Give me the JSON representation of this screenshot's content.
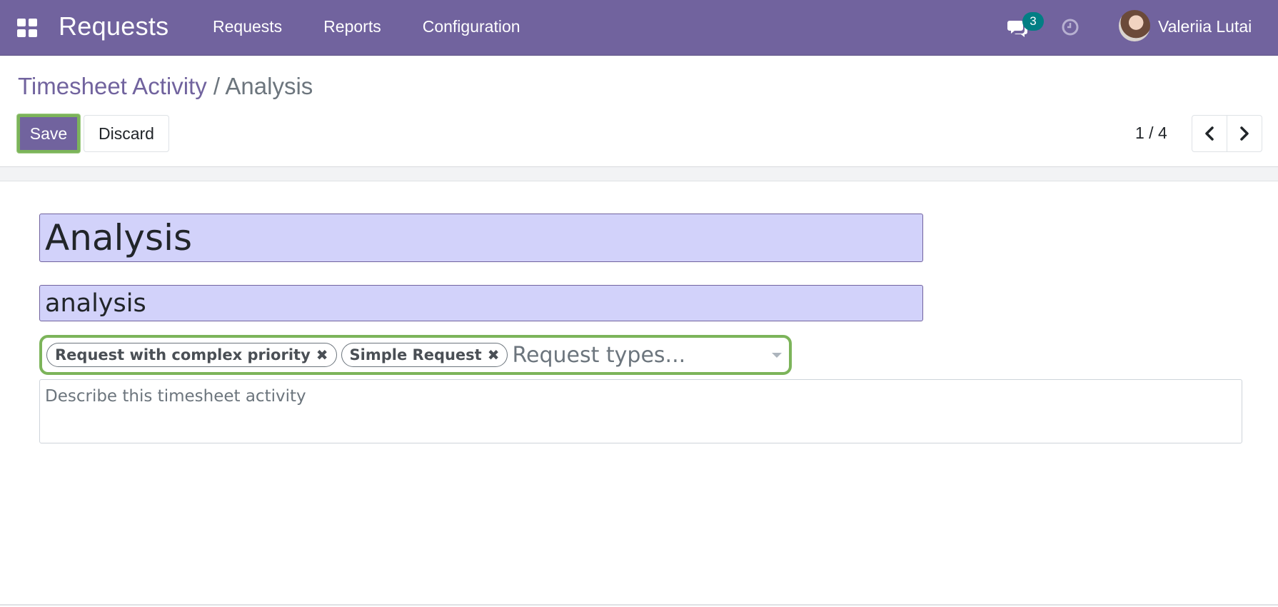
{
  "navbar": {
    "apps_icon": "grid-icon",
    "app_title": "Requests",
    "menu": [
      {
        "label": "Requests"
      },
      {
        "label": "Reports"
      },
      {
        "label": "Configuration"
      }
    ],
    "chat_icon": "chat-icon",
    "chat_badge_count": "3",
    "activity_icon": "clock-icon",
    "user_name": "Valeriia Lutai",
    "brand_color": "#71639e"
  },
  "control_panel": {
    "breadcrumb_parent": "Timesheet Activity",
    "breadcrumb_separator": " / ",
    "breadcrumb_current": "Analysis",
    "save_label": "Save",
    "discard_label": "Discard",
    "pager_value": "1 / 4",
    "prev_icon": "chevron-left-icon",
    "next_icon": "chevron-right-icon"
  },
  "form": {
    "name_value": "Analysis",
    "code_value": "analysis",
    "request_types": {
      "tags": [
        {
          "label": "Request with complex priority"
        },
        {
          "label": "Simple Request"
        }
      ],
      "placeholder": "Request types...",
      "remove_icon": "close-icon"
    },
    "description_placeholder": "Describe this timesheet activity",
    "highlight_color": "#7cb45a",
    "input_bg_color": "#d2d2fa"
  }
}
